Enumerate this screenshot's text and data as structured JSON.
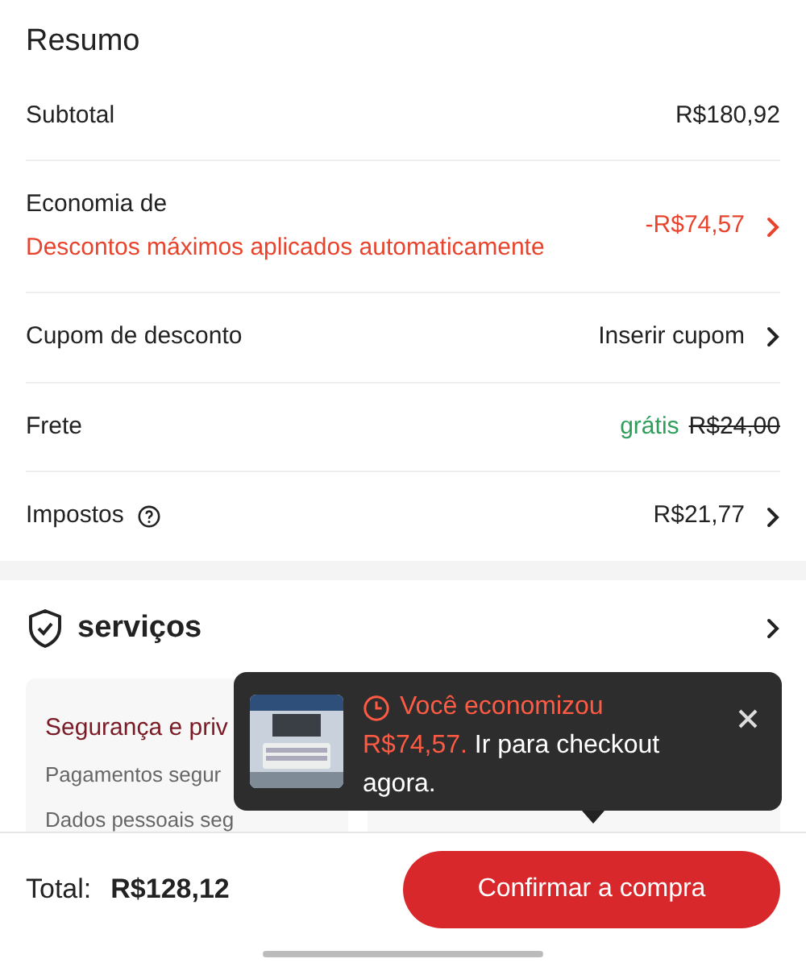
{
  "summary": {
    "title": "Resumo",
    "rows": [
      {
        "kind": "plain",
        "label": "Subtotal",
        "value": "R$180,92",
        "chevron": false
      },
      {
        "kind": "savings",
        "label": "Economia de",
        "note": "Descontos máximos aplicados automaticamente",
        "value": "-R$74,57",
        "chevron": true
      },
      {
        "kind": "plain",
        "label": "Cupom de desconto",
        "value": "Inserir cupom",
        "chevron": true
      },
      {
        "kind": "shipping",
        "label": "Frete",
        "free": "grátis",
        "value": "R$24,00",
        "chevron": false
      },
      {
        "kind": "help",
        "label": "Impostos",
        "value": "R$21,77",
        "chevron": true
      }
    ]
  },
  "services": {
    "title": "serviços",
    "card": {
      "title": "Segurança e priv",
      "lines": [
        "Pagamentos segur",
        "Dados pessoais seg"
      ]
    }
  },
  "toast": {
    "headline": "Você economizou",
    "amount": "R$74,57.",
    "message": "Ir para checkout agora."
  },
  "footer": {
    "total_label": "Total:",
    "total": "R$128,12",
    "button": "Confirmar a compra"
  }
}
